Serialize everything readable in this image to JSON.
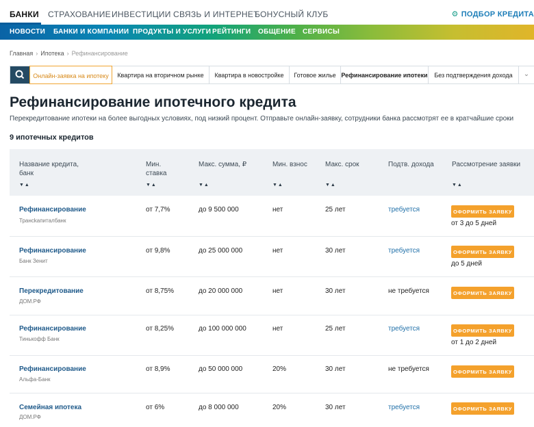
{
  "top_nav": {
    "items": [
      "БАНКИ",
      "СТРАХОВАНИЕ",
      "ИНВЕСТИЦИИ",
      "СВЯЗЬ И ИНТЕРНЕТ",
      "БОНУСНЫЙ КЛУБ"
    ],
    "pick_label": "ПОДБОР КРЕДИТА"
  },
  "color_nav": {
    "items": [
      "НОВОСТИ",
      "БАНКИ И КОМПАНИИ",
      "ПРОДУКТЫ И УСЛУГИ",
      "РЕЙТИНГИ",
      "ОБЩЕНИЕ",
      "СЕРВИСЫ"
    ]
  },
  "breadcrumb": {
    "items": [
      "Главная",
      "Ипотека",
      "Рефинансирование"
    ]
  },
  "tabs": {
    "items": [
      "Онлайн-заявка на ипотеку",
      "Квартира на вторичном рынке",
      "Квартира в новостройке",
      "Готовое жилье",
      "Рефинансирование ипотеки",
      "Без подтверждения дохода"
    ]
  },
  "page": {
    "title": "Рефинансирование ипотечного кредита",
    "subtitle": "Перекредитование ипотеки на более выгодных условиях, под низкий процент. Отправьте онлайн-заявку, сотрудники банка рассмотрят ее в кратчайшие сроки",
    "count": "9 ипотечных кредитов"
  },
  "table": {
    "headers": {
      "name1": "Название кредита,",
      "name2": "банк",
      "rate1": "Мин.",
      "rate2": "ставка",
      "sum": "Макс. сумма, ₽",
      "down": "Мин. взнос",
      "term": "Макс. срок",
      "income": "Подтв. дохода",
      "review": "Рассмотрение заявки"
    },
    "button_label": "ОФОРМИТЬ ЗАЯВКУ",
    "rows": [
      {
        "name": "Рефинансирование",
        "bank": "Трансkапиталбанк",
        "rate": "от 7,7%",
        "sum": "до 9 500 000",
        "down": "нет",
        "term": "25 лет",
        "income": "требуется",
        "review": "от 3 до 5 дней"
      },
      {
        "name": "Рефинансирование",
        "bank": "Банк Зенит",
        "rate": "от 9,8%",
        "sum": "до 25 000 000",
        "down": "нет",
        "term": "30 лет",
        "income": "требуется",
        "review": "до 5 дней"
      },
      {
        "name": "Перекредитование",
        "bank": "ДОМ.РФ",
        "rate": "от 8,75%",
        "sum": "до 20 000 000",
        "down": "нет",
        "term": "30 лет",
        "income": "не требуется",
        "review": ""
      },
      {
        "name": "Рефинансирование",
        "bank": "Тинькофф Банк",
        "rate": "от 8,25%",
        "sum": "до 100 000 000",
        "down": "нет",
        "term": "25 лет",
        "income": "требуется",
        "review": "от 1 до 2 дней"
      },
      {
        "name": "Рефинансирование",
        "bank": "Альфа-Банк",
        "rate": "от 8,9%",
        "sum": "до 50 000 000",
        "down": "20%",
        "term": "30 лет",
        "income": "не требуется",
        "review": ""
      },
      {
        "name": "Семейная ипотека",
        "bank": "ДОМ.РФ",
        "rate": "от 6%",
        "sum": "до 8 000 000",
        "down": "20%",
        "term": "30 лет",
        "income": "требуется",
        "review": ""
      }
    ]
  },
  "icons": {
    "search": "search-icon",
    "gear": "gear-icon",
    "chevron": "chevron-down-icon",
    "sort": "sort-arrows-icon"
  },
  "colors": {
    "accent_orange": "#f4a12c",
    "nav_blue": "#0a63a6",
    "link_blue": "#1f5a8a"
  }
}
